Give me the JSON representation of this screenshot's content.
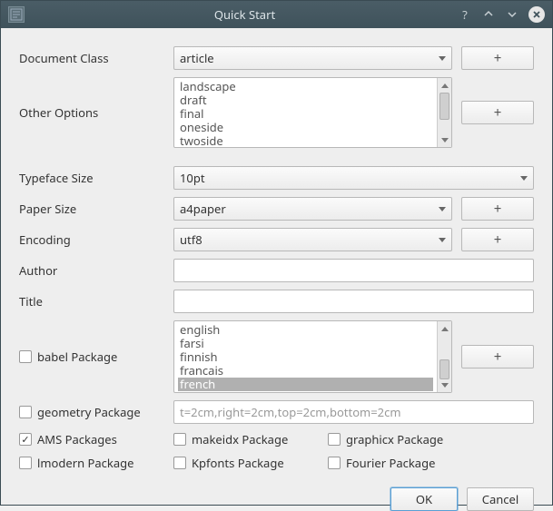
{
  "title": "Quick Start",
  "labels": {
    "documentClass": "Document Class",
    "otherOptions": "Other Options",
    "typefaceSize": "Typeface Size",
    "paperSize": "Paper Size",
    "encoding": "Encoding",
    "author": "Author",
    "title": "Title",
    "babel": "babel Package",
    "geometry": "geometry Package",
    "ams": "AMS Packages",
    "lmodern": "lmodern Package",
    "makeidx": "makeidx Package",
    "kpfonts": "Kpfonts Package",
    "graphicx": "graphicx Package",
    "fourier": "Fourier Package"
  },
  "values": {
    "documentClass": "article",
    "typefaceSize": "10pt",
    "paperSize": "a4paper",
    "encoding": "utf8",
    "geometryValue": "t=2cm,right=2cm,top=2cm,bottom=2cm"
  },
  "otherOptions": [
    "landscape",
    "draft",
    "final",
    "oneside",
    "twoside"
  ],
  "babelOptions": [
    "english",
    "farsi",
    "finnish",
    "francais",
    "french"
  ],
  "babelSelected": "french",
  "buttons": {
    "ok": "OK",
    "cancel": "Cancel"
  }
}
